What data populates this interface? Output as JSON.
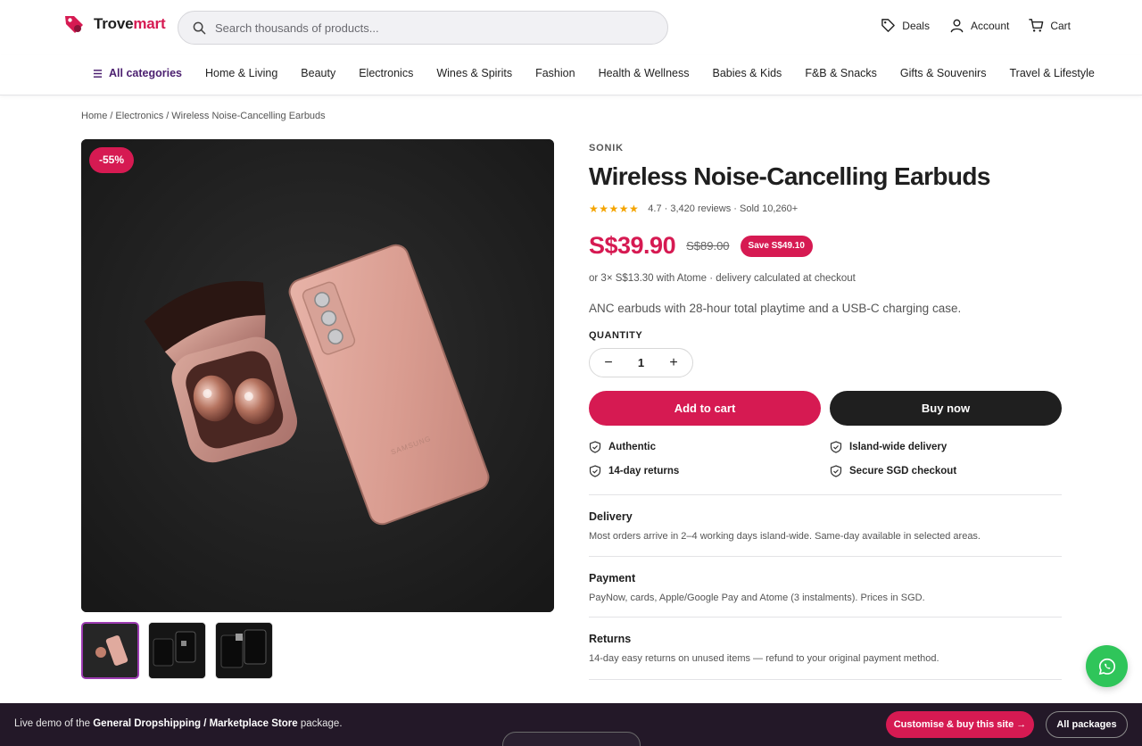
{
  "brand": {
    "name_part1": "Trove",
    "name_part2": "mart"
  },
  "search": {
    "placeholder": "Search thousands of products..."
  },
  "top_actions": [
    {
      "label": "Deals",
      "icon": "tag-icon"
    },
    {
      "label": "Account",
      "icon": "user-icon"
    },
    {
      "label": "Cart",
      "icon": "cart-icon"
    }
  ],
  "nav": {
    "all_label": "All categories",
    "items": [
      "Home & Living",
      "Beauty",
      "Electronics",
      "Wines & Spirits",
      "Fashion",
      "Health & Wellness",
      "Babies & Kids",
      "F&B & Snacks",
      "Gifts & Souvenirs",
      "Travel & Lifestyle"
    ]
  },
  "breadcrumb": {
    "home": "Home",
    "category": "Electronics",
    "current": "Wireless Noise-Cancelling Earbuds",
    "sep": "/"
  },
  "gallery": {
    "discount": "-55%",
    "thumb_count": 3,
    "active_thumb": 0
  },
  "product": {
    "brand": "SONIK",
    "title": "Wireless Noise-Cancelling Earbuds",
    "stars": "★★★★★",
    "rating_text": "4.7 · 3,420 reviews · Sold 10,260+",
    "price": "S$39.90",
    "old_price": "S$89.00",
    "save": "Save S$49.10",
    "installment": "or 3× S$13.30 with Atome · delivery calculated at checkout",
    "description": "ANC earbuds with 28-hour total playtime and a USB-C charging case.",
    "quantity_label": "QUANTITY",
    "quantity": "1",
    "add_to_cart": "Add to cart",
    "buy_now": "Buy now"
  },
  "features": [
    "Authentic",
    "Island-wide delivery",
    "14-day returns",
    "Secure SGD checkout"
  ],
  "sections": [
    {
      "title": "Delivery",
      "text": "Most orders arrive in 2–4 working days island-wide. Same-day available in selected areas."
    },
    {
      "title": "Payment",
      "text": "PayNow, cards, Apple/Google Pay and Atome (3 instalments). Prices in SGD."
    },
    {
      "title": "Returns",
      "text": "14-day easy returns on unused items — refund to your original payment method."
    }
  ],
  "demo_bar": {
    "text_prefix": "Live demo of the ",
    "package": "General Dropshipping / Marketplace Store",
    "text_suffix": " package.",
    "cta": "Customise & buy this site →",
    "all_packages": "All packages"
  },
  "colors": {
    "accent": "#d61a52",
    "nav_accent": "#4b1f6f",
    "dark": "#1f1f1f",
    "whatsapp": "#2fc55a",
    "star": "#f4a400"
  }
}
